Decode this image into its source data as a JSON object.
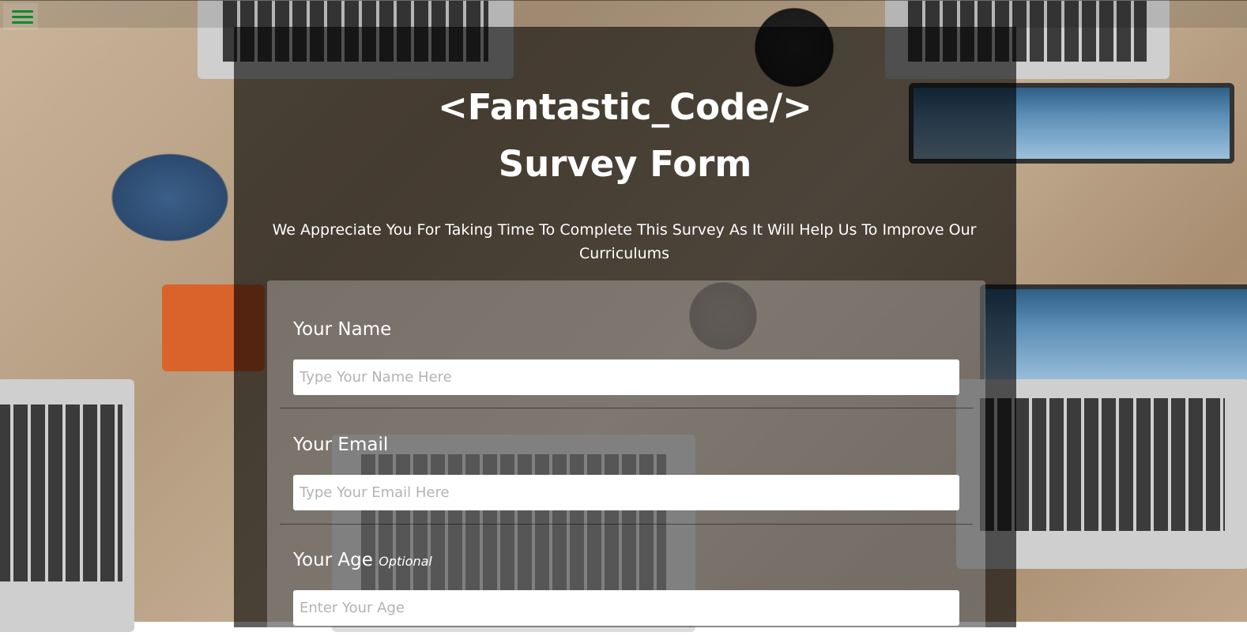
{
  "header": {
    "menu_icon": "hamburger-menu-icon",
    "accent_color": "#0a8a2c"
  },
  "title": {
    "line1": "<Fantastic_Code/>",
    "line2": "Survey Form"
  },
  "description": "We Appreciate You For Taking Time To Complete This Survey As It Will Help Us To Improve Our Curriculums",
  "form": {
    "name": {
      "label": "Your Name",
      "placeholder": "Type Your Name Here"
    },
    "email": {
      "label": "Your Email",
      "placeholder": "Type Your Email Here"
    },
    "age": {
      "label": "Your Age",
      "optional_tag": "Optional",
      "placeholder": "Enter Your Age"
    }
  }
}
